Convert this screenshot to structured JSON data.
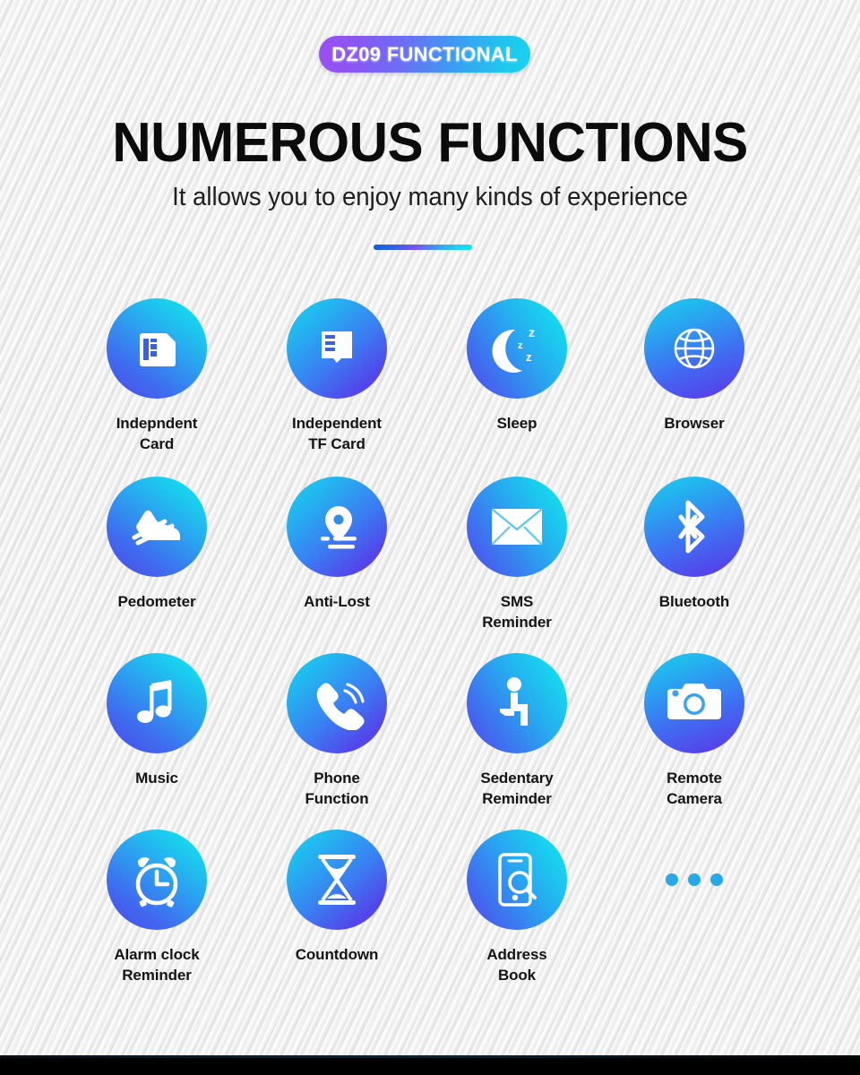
{
  "badge": {
    "label": "DZ09 FUNCTIONAL"
  },
  "header": {
    "title": "NUMEROUS FUNCTIONS",
    "subtitle": "It allows you to enjoy many kinds of experience"
  },
  "colors": {
    "gradient_start_purple": "#9b4ff0",
    "gradient_end_cyan": "#18d3ee",
    "icon_gradient_indigo": "#5446ea",
    "icon_gradient_cyan": "#14e0f0",
    "dot_blue": "#29a8e8",
    "background": "#e8e8e8",
    "text_dark": "#141414",
    "bottom_band": "#000000"
  },
  "features": [
    {
      "icon": "sim-card-icon",
      "label": "Indepndent\nCard"
    },
    {
      "icon": "tf-card-icon",
      "label": "Independent\nTF Card"
    },
    {
      "icon": "sleep-moon-icon",
      "label": "Sleep"
    },
    {
      "icon": "globe-browser-icon",
      "label": "Browser"
    },
    {
      "icon": "running-shoe-icon",
      "label": "Pedometer"
    },
    {
      "icon": "location-pin-icon",
      "label": "Anti-Lost"
    },
    {
      "icon": "envelope-icon",
      "label": "SMS\nReminder"
    },
    {
      "icon": "bluetooth-icon",
      "label": "Bluetooth"
    },
    {
      "icon": "music-note-icon",
      "label": "Music"
    },
    {
      "icon": "phone-handset-icon",
      "label": "Phone\nFunction"
    },
    {
      "icon": "sitting-person-icon",
      "label": "Sedentary\nReminder"
    },
    {
      "icon": "camera-icon",
      "label": "Remote\nCamera"
    },
    {
      "icon": "alarm-clock-icon",
      "label": "Alarm clock\nReminder"
    },
    {
      "icon": "hourglass-icon",
      "label": "Countdown"
    },
    {
      "icon": "phone-search-icon",
      "label": "Address\nBook"
    },
    {
      "icon": "ellipsis-dots-icon",
      "label": ""
    }
  ]
}
